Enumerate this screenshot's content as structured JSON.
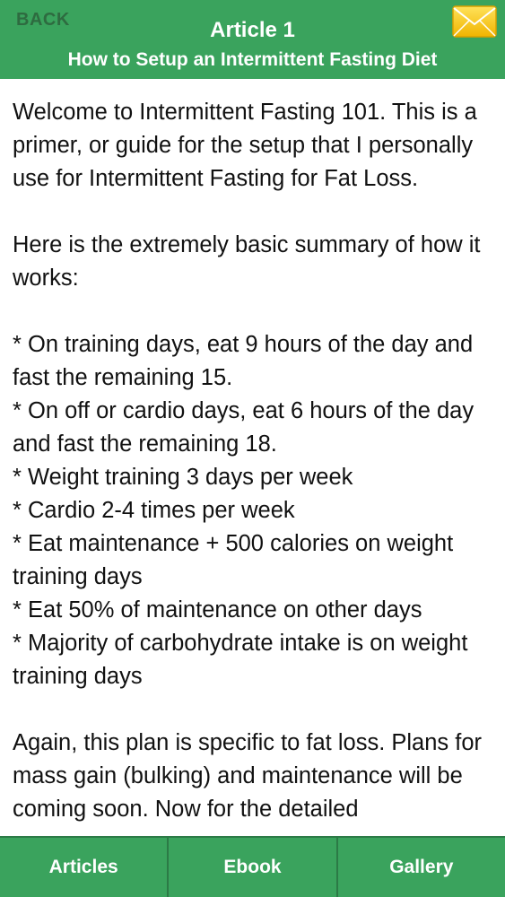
{
  "header": {
    "back_label": "BACK",
    "title": "Article 1",
    "subtitle": "How to Setup an Intermittent Fasting Diet",
    "mail_icon": "envelope-icon",
    "accent_color": "#3aa35d",
    "mail_color": "#f5c518"
  },
  "article": {
    "paragraph_1": "Welcome to Intermittent Fasting 101. This is a primer, or guide for the setup that I personally use for Intermittent Fasting for Fat Loss.",
    "paragraph_2": "Here is the extremely basic summary of how it works:",
    "bullets": [
      "* On training days, eat 9 hours of the day and fast the remaining 15.",
      "* On off or cardio days, eat 6 hours of the day and fast the remaining 18.",
      "* Weight training 3 days per week",
      "* Cardio 2-4 times per week",
      "* Eat maintenance + 500 calories on weight training days",
      "* Eat 50% of maintenance on other days",
      "* Majority of carbohydrate intake is on weight training days"
    ],
    "paragraph_3": "Again, this plan is specific to fat loss. Plans for mass gain (bulking) and maintenance will be coming soon. Now for the detailed"
  },
  "tabs": [
    {
      "label": "Articles"
    },
    {
      "label": "Ebook"
    },
    {
      "label": "Gallery"
    }
  ]
}
